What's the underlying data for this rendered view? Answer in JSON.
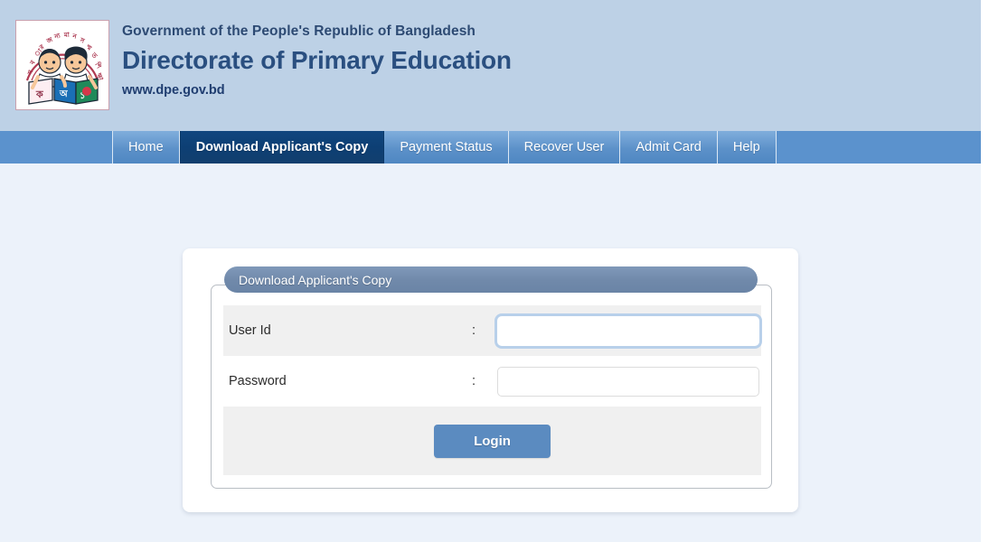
{
  "header": {
    "gov_line": "Government of the People's Republic of Bangladesh",
    "department": "Directorate of Primary Education",
    "website": "www.dpe.gov.bd",
    "logo_alt": "dpe-logo",
    "banner_color": "#bdd1e6",
    "title_color": "#2a4f80"
  },
  "nav": {
    "active_color": "#10467f",
    "tab_color": "#5c91c9",
    "items": [
      {
        "label": "Home",
        "active": false
      },
      {
        "label": "Download Applicant's Copy",
        "active": true
      },
      {
        "label": "Payment Status",
        "active": false
      },
      {
        "label": "Recover User",
        "active": false
      },
      {
        "label": "Admit Card",
        "active": false
      },
      {
        "label": "Help",
        "active": false
      }
    ]
  },
  "panel": {
    "legend": "Download Applicant's Copy",
    "legend_color": "#7089aa",
    "fields": [
      {
        "label": "User Id",
        "separator": ":",
        "value": "",
        "placeholder": "",
        "type": "text",
        "focused": true
      },
      {
        "label": "Password",
        "separator": ":",
        "value": "",
        "placeholder": "",
        "type": "password",
        "focused": false
      }
    ],
    "submit_label": "Login",
    "submit_color": "#5b8bc0"
  },
  "background": {
    "content": "#ecf2fa",
    "card": "#ffffff",
    "row_stripe": "#f0f0f0"
  }
}
